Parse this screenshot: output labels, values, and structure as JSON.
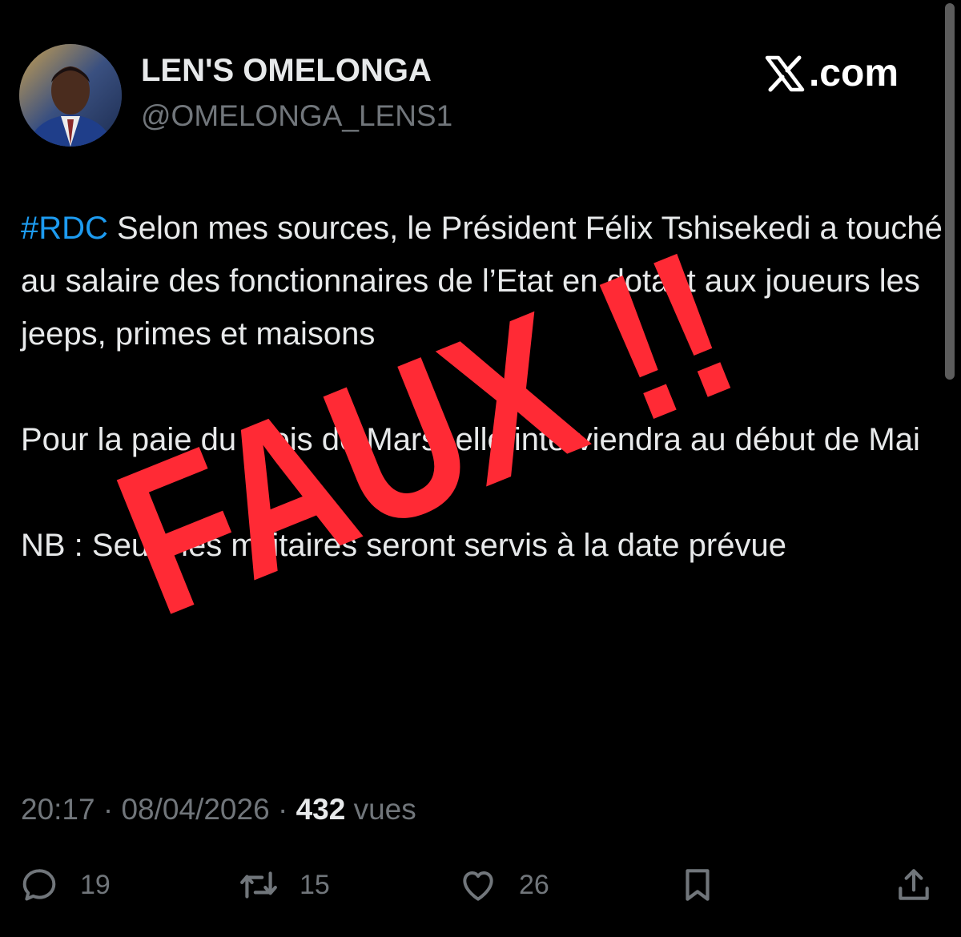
{
  "author": {
    "name": "LEN'S OMELONGA",
    "handle": "@OMELONGA_LENS1"
  },
  "brand": {
    "label": ".com",
    "icon": "x-logo-icon"
  },
  "tweet": {
    "hashtag": "#RDC",
    "line1_rest": " Selon mes sources, le Président Félix Tshisekedi a touché au salaire des fonctionnaires de l’Etat en dotant aux joueurs les jeeps, primes et maisons",
    "paragraph2": "Pour la paie du mois de Mars, elle interviendra au début de Mai",
    "paragraph3": "NB : Seuls les militaires seront servis à la date prévue"
  },
  "stamp": {
    "text": "FAUX !!",
    "color": "#ff2a35"
  },
  "meta": {
    "time": "20:17",
    "date": "08/04/2026",
    "separator": " · ",
    "views_count": "432",
    "views_label": " vues"
  },
  "actions": {
    "reply": {
      "icon": "reply-icon",
      "count": "19"
    },
    "retweet": {
      "icon": "retweet-icon",
      "count": "15"
    },
    "like": {
      "icon": "heart-icon",
      "count": "26"
    },
    "bookmark": {
      "icon": "bookmark-icon"
    },
    "share": {
      "icon": "share-icon"
    }
  },
  "colors": {
    "background": "#000000",
    "text": "#e7e9ea",
    "muted": "#71767b",
    "link": "#1d9bf0"
  }
}
